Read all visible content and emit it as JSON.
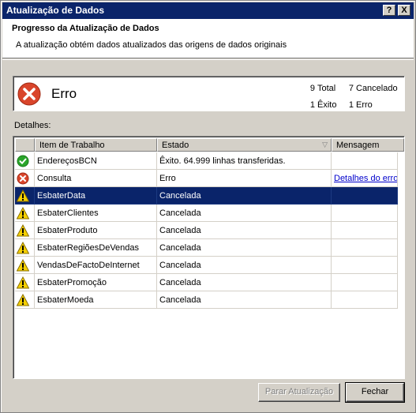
{
  "window": {
    "title": "Atualização de Dados",
    "help_button": "?",
    "close_button": "X"
  },
  "header": {
    "title": "Progresso da Atualização de Dados",
    "subtitle": "A atualização obtém dados atualizados das origens de dados originais"
  },
  "status": {
    "text": "Erro",
    "icon": "error-icon",
    "total_count": "9",
    "total_label": "Total",
    "cancelled_count": "7",
    "cancelled_label": "Cancelado",
    "success_count": "1",
    "success_label": "Êxito",
    "error_count": "1",
    "error_label": "Erro"
  },
  "details": {
    "label": "Detalhes:",
    "columns": [
      "Item de Trabalho",
      "Estado",
      "Mensagem"
    ],
    "rows": [
      {
        "icon": "success-icon",
        "item": "EndereçosBCN",
        "state": "Êxito. 64.999 linhas transferidas.",
        "message": ""
      },
      {
        "icon": "error-icon",
        "item": "Consulta",
        "state": "Erro",
        "message": "Detalhes do erro"
      },
      {
        "icon": "warning-icon",
        "item": "EsbaterData",
        "state": "Cancelada",
        "message": ""
      },
      {
        "icon": "warning-icon",
        "item": "EsbaterClientes",
        "state": "Cancelada",
        "message": ""
      },
      {
        "icon": "warning-icon",
        "item": "EsbaterProduto",
        "state": "Cancelada",
        "message": ""
      },
      {
        "icon": "warning-icon",
        "item": "EsbaterRegiõesDeVendas",
        "state": "Cancelada",
        "message": ""
      },
      {
        "icon": "warning-icon",
        "item": "VendasDeFactoDeInternet",
        "state": "Cancelada",
        "message": ""
      },
      {
        "icon": "warning-icon",
        "item": "EsbaterPromoção",
        "state": "Cancelada",
        "message": ""
      },
      {
        "icon": "warning-icon",
        "item": "EsbaterMoeda",
        "state": "Cancelada",
        "message": ""
      }
    ],
    "selected_row": 2
  },
  "buttons": {
    "stop_refresh": "Parar Atualização",
    "close": "Fechar"
  },
  "colors": {
    "titlebar": "#0a246a",
    "selection": "#0a246a",
    "error_red": "#d9452b",
    "success_green": "#2aa52a",
    "warning_yellow": "#f5d000",
    "link": "#0000cc"
  }
}
